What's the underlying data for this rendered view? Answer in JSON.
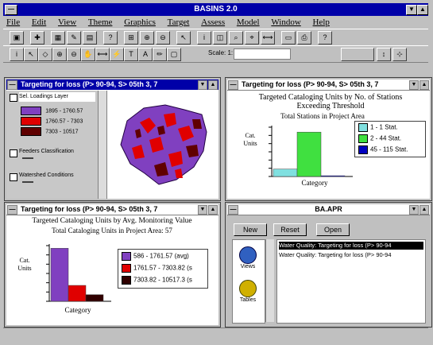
{
  "app": {
    "title": "BASINS 2.0"
  },
  "menu": [
    "File",
    "Edit",
    "View",
    "Theme",
    "Graphics",
    "Target",
    "Assess",
    "Model",
    "Window",
    "Help"
  ],
  "toolbar": {
    "scale_label": "Scale: 1:"
  },
  "map_window": {
    "title": "Targeting for loss (P> 90-94, S> 05th 3, 7",
    "legend_items": [
      {
        "label": "Sel. Loadings Layer",
        "color": "#ffffff"
      },
      {
        "label": "1895 - 1760.57",
        "color": "#8040c0"
      },
      {
        "label": "1760.57 - 7303",
        "color": "#e00000"
      },
      {
        "label": "7303 - 10517",
        "color": "#600000"
      }
    ],
    "layer2_label": "Feeders Classification",
    "layer3_label": "Watershed Conditions"
  },
  "chart1": {
    "window_title": "Targeting for loss (P> 90-94, S> 05th 3, 7",
    "title": "Targeted Cataloging Units by No. of Stations Exceeding Threshold",
    "subtitle": "Total Stations in Project Area",
    "ylabel": "Cat. Units",
    "xlabel": "Category",
    "legend": [
      {
        "label": "1 - 1 Stat.",
        "color": "#80e0e0"
      },
      {
        "label": "2 - 44 Stat.",
        "color": "#40e040"
      },
      {
        "label": "45 - 115 Stat.",
        "color": "#0000c0"
      }
    ]
  },
  "chart2": {
    "window_title": "Targeting for loss (P> 90-94, S> 05th 3, 7",
    "title": "Targeted Cataloging Units by Avg. Monitoring Value",
    "subtitle": "Total Cataloging Units in Project Area: 57",
    "ylabel": "Cat. Units",
    "xlabel": "Category",
    "legend": [
      {
        "label": "586 - 1761.57 (avg)",
        "color": "#8040c0"
      },
      {
        "label": "1761.57 - 7303.82 (s",
        "color": "#e00000"
      },
      {
        "label": "7303.82 - 10517.3 (s",
        "color": "#300000"
      }
    ]
  },
  "apr_window": {
    "title": "BA.APR",
    "buttons": [
      "New",
      "Reset",
      "Open"
    ],
    "icons": [
      "Views",
      "Tables"
    ],
    "items": [
      "Water Quality: Targeting for loss (P> 90-94",
      "Water Quality: Targeting for loss (P> 90-94"
    ]
  },
  "chart_data": [
    {
      "type": "bar",
      "title": "Targeted Cataloging Units by No. of Stations Exceeding Threshold",
      "xlabel": "Category",
      "ylabel": "Cat. Units",
      "categories": [
        "1 - 1 Stat.",
        "2 - 44 Stat.",
        "45 - 115 Stat."
      ],
      "values": [
        3,
        18,
        0.3
      ]
    },
    {
      "type": "bar",
      "title": "Targeted Cataloging Units by Avg. Monitoring Value",
      "xlabel": "Category",
      "ylabel": "Cat. Units",
      "categories": [
        "586 - 1761.57",
        "1761.57 - 7303.82",
        "7303.82 - 10517.3"
      ],
      "values": [
        40,
        12,
        5
      ]
    }
  ]
}
